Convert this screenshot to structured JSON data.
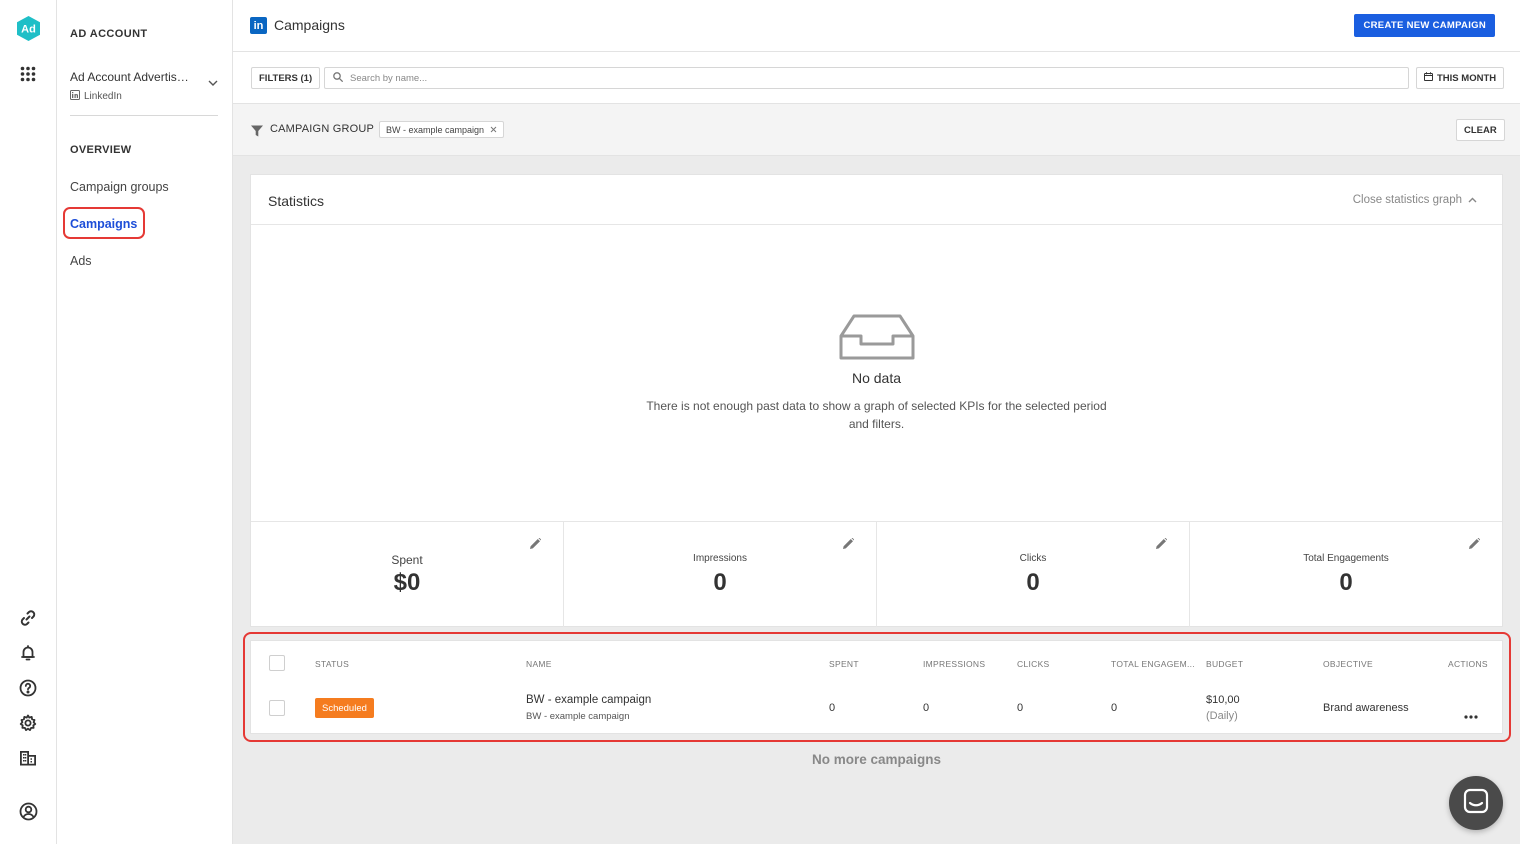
{
  "rail": {
    "logo_text": "Ad",
    "accent": "#1fbfc7"
  },
  "sidenav": {
    "heading": "AD ACCOUNT",
    "account_name": "Ad Account Advertise ...",
    "account_platform": "LinkedIn",
    "section": "OVERVIEW",
    "items": [
      {
        "label": "Campaign groups"
      },
      {
        "label": "Campaigns"
      },
      {
        "label": "Ads"
      }
    ]
  },
  "header": {
    "platform_logo": "in",
    "title": "Campaigns",
    "create_label": "CREATE NEW CAMPAIGN"
  },
  "filters": {
    "filters_label": "FILTERS (1)",
    "search_placeholder": "Search by name...",
    "period_label": "THIS MONTH"
  },
  "group_filter": {
    "label": "CAMPAIGN GROUP",
    "chip": "BW - example campaign",
    "clear_label": "CLEAR"
  },
  "statistics": {
    "title": "Statistics",
    "close_label": "Close statistics graph",
    "nodata_title": "No data",
    "nodata_text": "There is not enough past data to show a graph of selected KPIs for the selected period and filters.",
    "kpis": [
      {
        "label": "Spent",
        "value": "$0"
      },
      {
        "label": "Impressions",
        "value": "0"
      },
      {
        "label": "Clicks",
        "value": "0"
      },
      {
        "label": "Total Engagements",
        "value": "0"
      }
    ]
  },
  "table": {
    "columns": [
      "STATUS",
      "NAME",
      "SPENT",
      "IMPRESSIONS",
      "CLICKS",
      "TOTAL ENGAGEM...",
      "BUDGET",
      "OBJECTIVE",
      "ACTIONS"
    ],
    "rows": [
      {
        "status": "Scheduled",
        "name": "BW - example campaign",
        "group": "BW - example campaign",
        "spent": "0",
        "impressions": "0",
        "clicks": "0",
        "engagements": "0",
        "budget": "$10,00",
        "budget_period": "(Daily)",
        "objective": "Brand awareness"
      }
    ],
    "footer": "No more campaigns"
  },
  "colors": {
    "primary": "#1a5ee0",
    "scheduled": "#f57c1f",
    "highlight": "#e53935",
    "linkedin": "#0a66c2"
  }
}
